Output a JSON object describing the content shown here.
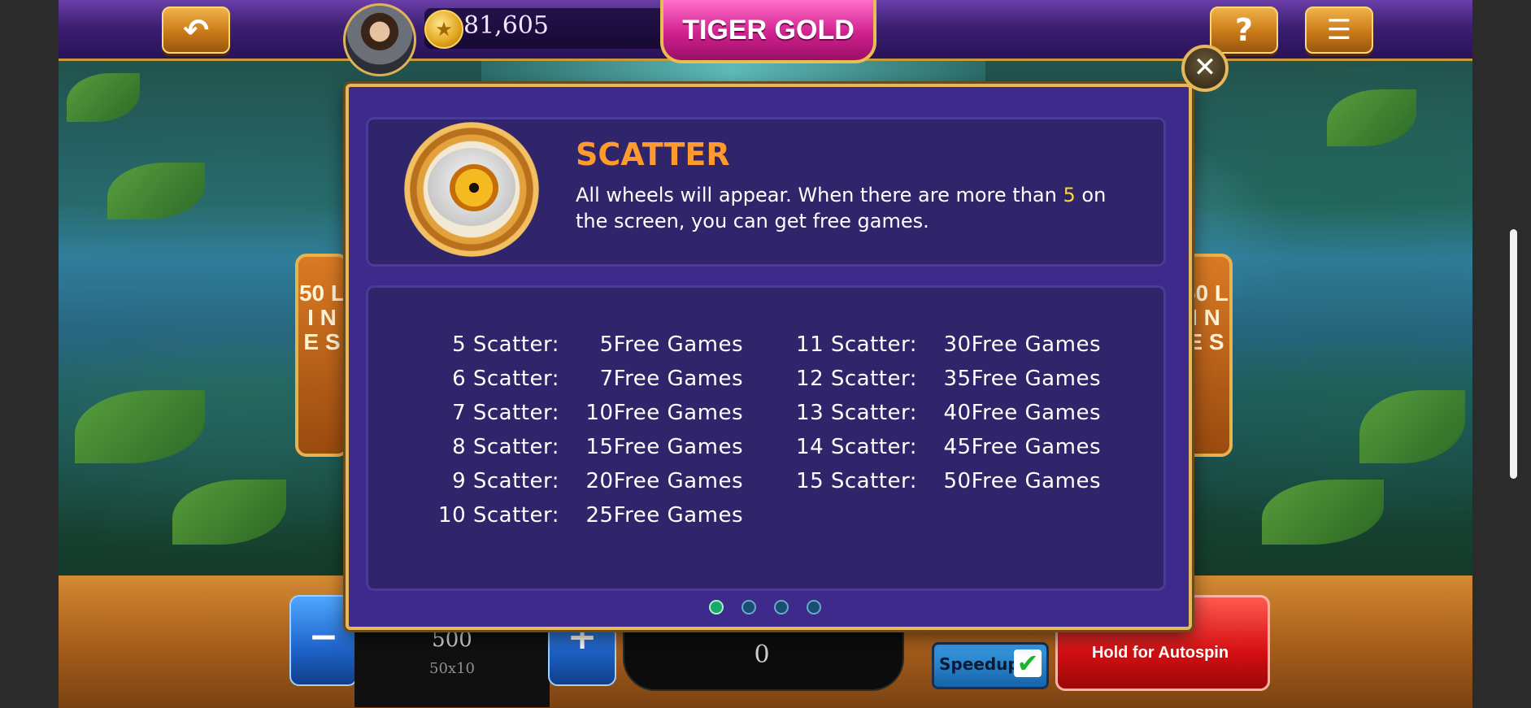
{
  "header": {
    "back_icon": "back-arrow-icon",
    "coin_icon": "gold-star-coin-icon",
    "coins": "81,605",
    "game_title": "TIGER GOLD",
    "help_label": "?",
    "menu_icon": "menu-list-icon"
  },
  "side_signs": {
    "left": "50 L I N E S",
    "right": "50 L I N E S"
  },
  "dialog": {
    "close_icon": "close-x-icon",
    "symbol_icon": "scatter-eye-icon",
    "title": "SCATTER",
    "desc_before": "All wheels will appear. When there are more than ",
    "desc_highlight": "5",
    "desc_after": " on the screen, you can get free games.",
    "payouts_left": [
      {
        "count": "5 Scatter:",
        "reward": "5Free Games"
      },
      {
        "count": "6 Scatter:",
        "reward": "7Free Games"
      },
      {
        "count": "7 Scatter:",
        "reward": "10Free Games"
      },
      {
        "count": "8 Scatter:",
        "reward": "15Free Games"
      },
      {
        "count": "9 Scatter:",
        "reward": "20Free Games"
      },
      {
        "count": "10 Scatter:",
        "reward": "25Free Games"
      }
    ],
    "payouts_right": [
      {
        "count": "11 Scatter:",
        "reward": "30Free Games"
      },
      {
        "count": "12 Scatter:",
        "reward": "35Free Games"
      },
      {
        "count": "13 Scatter:",
        "reward": "40Free Games"
      },
      {
        "count": "14 Scatter:",
        "reward": "45Free Games"
      },
      {
        "count": "15 Scatter:",
        "reward": "50Free Games"
      }
    ],
    "page_count": 4,
    "active_page": 1
  },
  "controls": {
    "minus_label": "−",
    "plus_label": "+",
    "bet": "500",
    "bet_lines": "50x10",
    "win": "0",
    "speedup_label": "Speedup",
    "speedup_checked": "✔",
    "spin_label": "Hold for Autospin"
  }
}
